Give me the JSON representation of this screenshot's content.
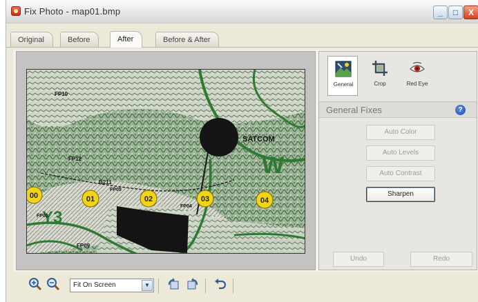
{
  "window": {
    "title": "Fix Photo - map01.bmp",
    "controls": {
      "minimize": "_",
      "maximize": "□",
      "close": "X"
    }
  },
  "tabs": [
    {
      "label": "Original",
      "active": false
    },
    {
      "label": "Before",
      "active": false
    },
    {
      "label": "After",
      "active": true
    },
    {
      "label": "Before & After",
      "active": false
    }
  ],
  "photo": {
    "map_labels": {
      "satcom": "SATCOM",
      "w": "W",
      "y3": "Y3",
      "fp10": "FP10",
      "fp12": "FP12",
      "b211": "B211",
      "fp04": "FP04",
      "fp03": "FP03",
      "fp05": "FP05",
      "fp09": "FP09"
    },
    "markers": [
      "00",
      "01",
      "02",
      "03",
      "04"
    ]
  },
  "panel": {
    "tools": [
      {
        "label": "General",
        "icon": "general-icon",
        "selected": true
      },
      {
        "label": "Crop",
        "icon": "crop-icon",
        "selected": false
      },
      {
        "label": "Red Eye",
        "icon": "red-eye-icon",
        "selected": false
      }
    ],
    "section_title": "General Fixes",
    "help_glyph": "?",
    "buttons": [
      {
        "label": "Auto Color",
        "enabled": false
      },
      {
        "label": "Auto Levels",
        "enabled": false
      },
      {
        "label": "Auto Contrast",
        "enabled": false
      },
      {
        "label": "Sharpen",
        "enabled": true
      }
    ],
    "undo_label": "Undo",
    "redo_label": "Redo"
  },
  "bottom": {
    "zoom_select_value": "Fit On Screen",
    "icons": [
      "zoom-in-icon",
      "zoom-out-icon",
      "rotate-left-icon",
      "rotate-right-icon",
      "undo-arrow-icon"
    ]
  },
  "colors": {
    "accent": "#1d4fb3",
    "map_green": "#2e7a33",
    "marker_yellow": "#f1d318"
  }
}
